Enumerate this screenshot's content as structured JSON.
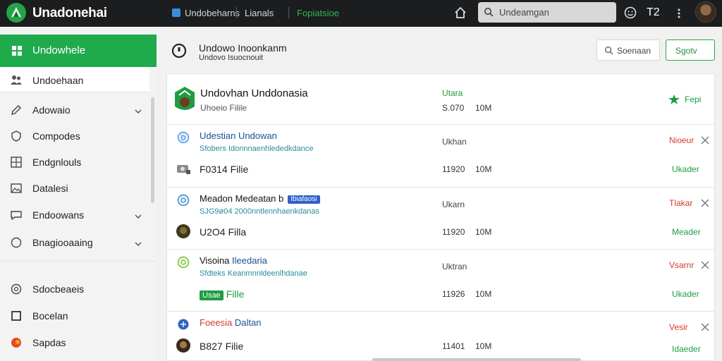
{
  "topbar": {
    "app_title": "Unadonehai",
    "nav": [
      "Undobeharns",
      "Lianals",
      "Fopiatsioe"
    ],
    "search_placeholder": "Undeamgan",
    "user_label": "T2",
    "colors": {
      "bar": "#1b1d1f",
      "accent": "#22a447"
    }
  },
  "sidebar": {
    "active": {
      "label": "Undowhele",
      "icon": "grid-icon"
    },
    "second": {
      "label": "Undoehaan",
      "icon": "people-icon"
    },
    "items": [
      {
        "label": "Adowaio",
        "icon": "pen-icon",
        "chevron": true
      },
      {
        "label": "Compodes",
        "icon": "shield-icon",
        "chevron": false
      },
      {
        "label": "Endgnlouls",
        "icon": "grid-box-icon",
        "chevron": false
      },
      {
        "label": "Datalesi",
        "icon": "image-icon",
        "chevron": false
      },
      {
        "label": "Endoowans",
        "icon": "chat-icon",
        "chevron": true
      },
      {
        "label": "Bnagiooaaing",
        "icon": "circle-icon",
        "chevron": true
      }
    ],
    "bottom_items": [
      {
        "label": "Sdocbeaeis",
        "icon": "settings-icon"
      },
      {
        "label": "Bocelan",
        "icon": "square-icon"
      },
      {
        "label": "Sapdas",
        "icon": "orange-dot-icon"
      }
    ]
  },
  "header": {
    "title": "Undowo Inoonkanm",
    "subtitle": "Undovo Isuocnouit",
    "search_button": "Soenaan",
    "sort_button": "Sgotv"
  },
  "hero": {
    "title": "Undovhan Unddonasia",
    "subtitle": "Uhoeio Filile",
    "status": "Utara",
    "num": "S.070",
    "size": "10M",
    "fav_label": "Fepi"
  },
  "entries": [
    {
      "title_blue": "Udestian",
      "title_rest": "Undowan",
      "tag": "",
      "desc": "Sfobers Idonnnaenhlededkdance",
      "right": "Ukhan",
      "file": "F0314 Filie",
      "file_badge": "",
      "num": "11920",
      "size": "10M",
      "status": "Nioeur",
      "action": "Ukader",
      "icon_color": "#4b9be0",
      "file_icon": "camera-icon"
    },
    {
      "title_blue": "",
      "title_rest": "Meadon Medeatan b",
      "tag": "Ibiafaosi",
      "desc": "SJG9ø04 2000nntlennhaenkdanas",
      "right": "Ukarn",
      "file": "U2O4 Filla",
      "file_badge": "",
      "num": "11920",
      "size": "10M",
      "status": "Tlakar",
      "action": "Meader",
      "icon_color": "#3a86c6",
      "file_icon": "avatar-icon"
    },
    {
      "title_blue": "",
      "title_rest": "Visoina",
      "title_blue2": "Ileedaria",
      "tag": "",
      "desc": "Sfdteks Keanmnnldeenlhdanae",
      "right": "Uktran",
      "file": "Fille",
      "file_badge": "Usae",
      "num": "11926",
      "size": "10M",
      "status": "Vsarnr",
      "action": "Ukader",
      "icon_color": "#6bbf2a",
      "file_icon": ""
    },
    {
      "title_red": "Foeesia",
      "title_blue": "Daltan",
      "title_rest": "",
      "tag": "",
      "desc": "",
      "right": "",
      "file": "B827 Filie",
      "file_badge": "",
      "num": "11401",
      "size": "10M",
      "status": "Vesir",
      "action": "Idaeder",
      "icon_color": "#2e63c1",
      "file_icon": "avatar-icon"
    }
  ]
}
